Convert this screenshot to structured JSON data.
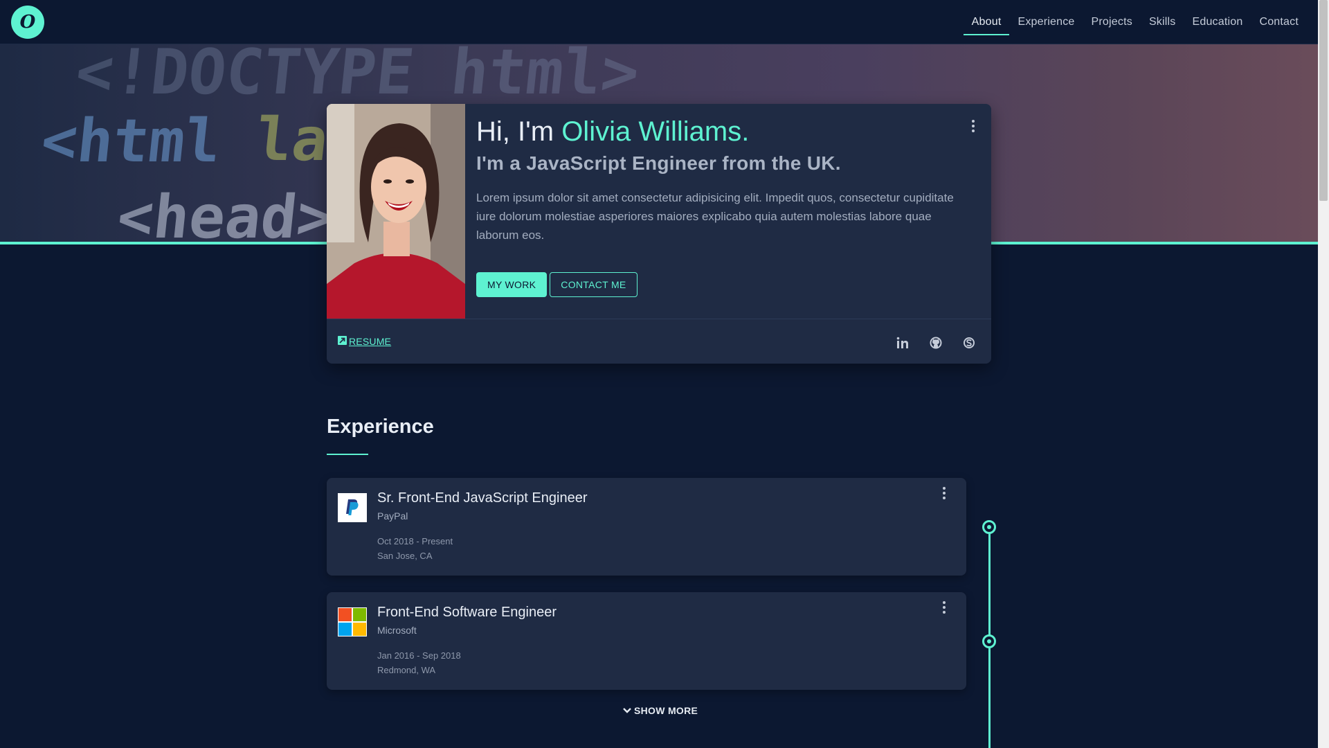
{
  "nav": {
    "logo_glyph": "O",
    "items": [
      {
        "label": "About",
        "active": true
      },
      {
        "label": "Experience",
        "active": false
      },
      {
        "label": "Projects",
        "active": false
      },
      {
        "label": "Skills",
        "active": false
      },
      {
        "label": "Education",
        "active": false
      },
      {
        "label": "Contact",
        "active": false
      }
    ]
  },
  "hero": {
    "greeting": "Hi, I'm ",
    "name": "Olivia Williams.",
    "subtitle": "I'm a JavaScript Engineer from the UK.",
    "bio": "Lorem ipsum dolor sit amet consectetur adipisicing elit. Impedit quos, consectetur cupiditate iure dolorum molestiae asperiores maiores explicabo quia autem molestias labore quae laborum eos.",
    "primary_button": "MY WORK",
    "secondary_button": "CONTACT ME",
    "resume_label": "RESUME",
    "social_icons": [
      "linkedin-icon",
      "github-icon",
      "skype-icon"
    ],
    "background_code_text": [
      "<!DOCTYPE html>",
      "<html",
      "lan",
      "<head>"
    ]
  },
  "experience": {
    "title": "Experience",
    "jobs": [
      {
        "title": "Sr. Front-End JavaScript Engineer",
        "company": "PayPal",
        "dates": "Oct 2018 - Present",
        "location": "San Jose, CA",
        "logo": "paypal-logo"
      },
      {
        "title": "Front-End Software Engineer",
        "company": "Microsoft",
        "dates": "Jan 2016 - Sep 2018",
        "location": "Redmond, WA",
        "logo": "microsoft-logo"
      }
    ],
    "show_more": "SHOW MORE"
  },
  "colors": {
    "accent": "#5ef2d1",
    "background": "#0c1831",
    "card": "#1f2b44"
  }
}
